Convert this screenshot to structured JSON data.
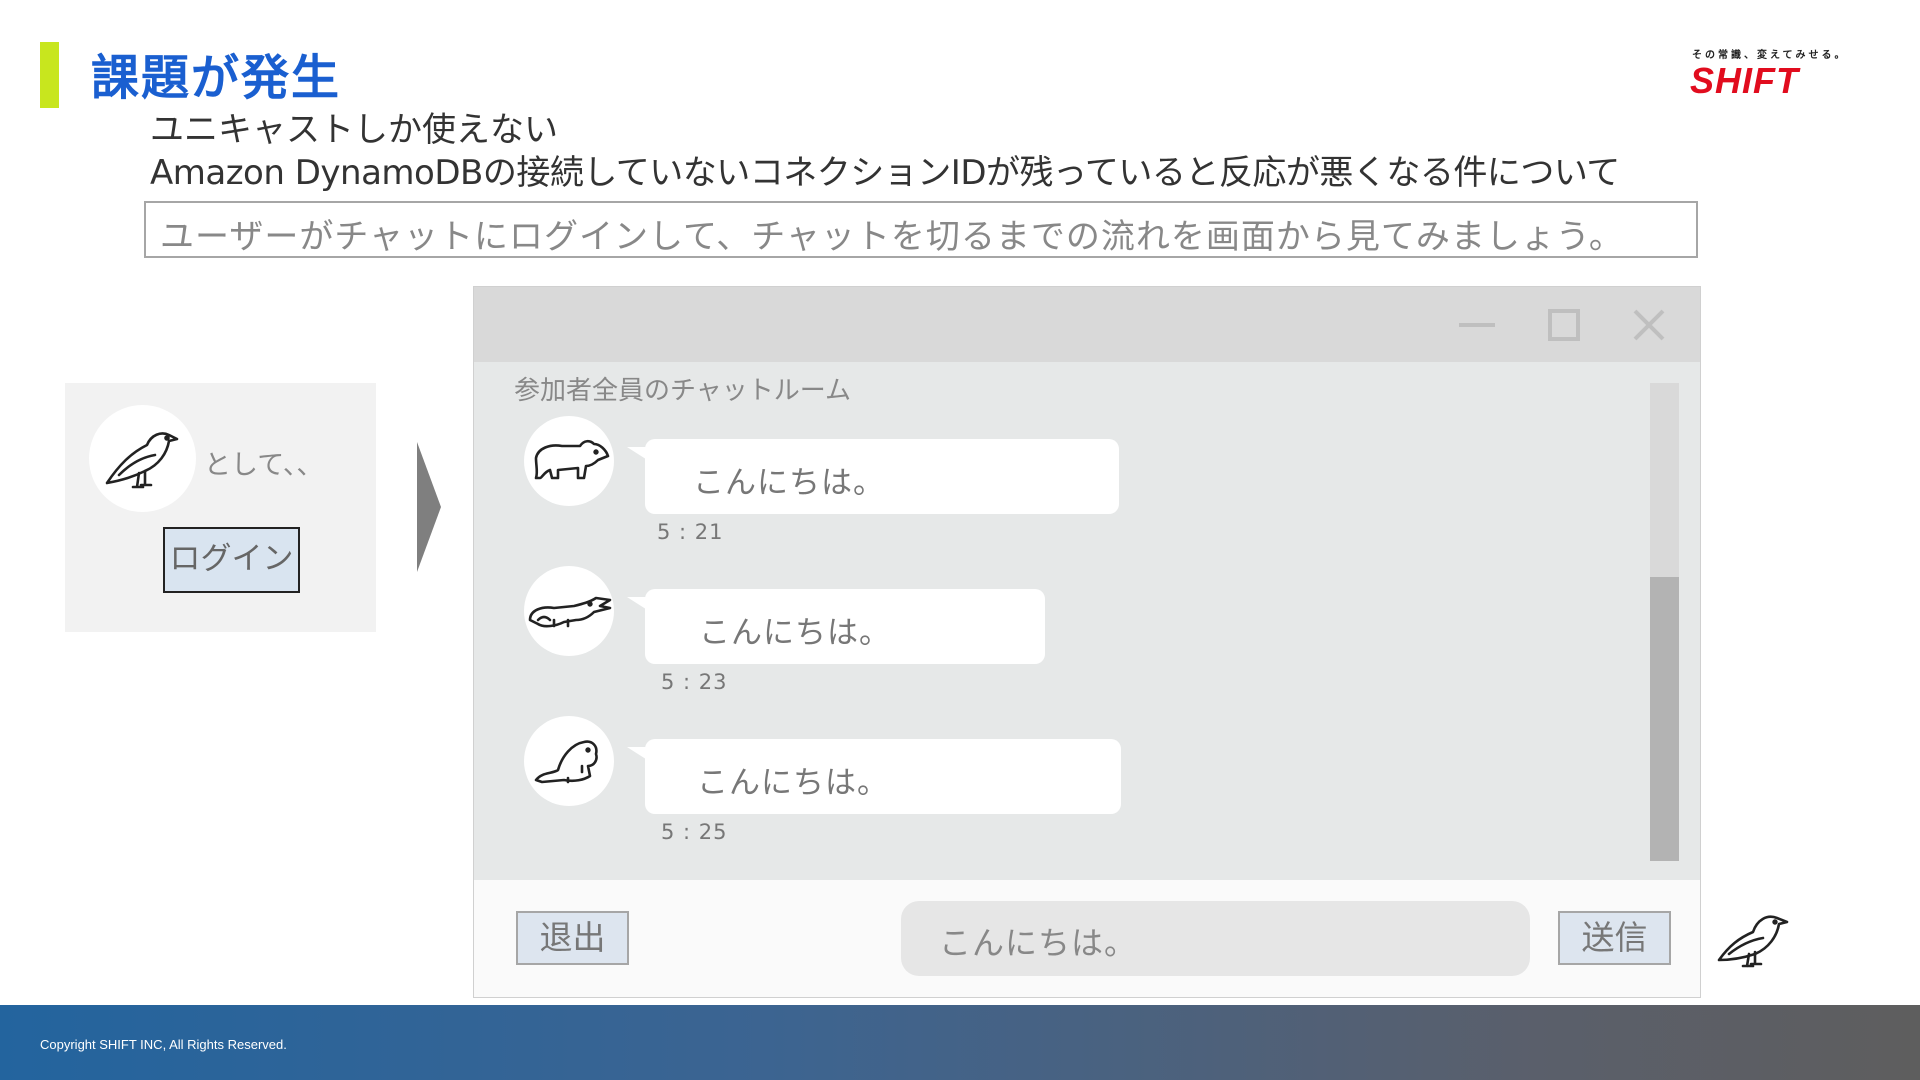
{
  "slide": {
    "title": "課題が発生",
    "subtitle_line1": "ユニキャストしか使えない",
    "subtitle_line2": "Amazon DynamoDBの接続していないコネクションIDが残っていると反応が悪くなる件について",
    "note": "ユーザーがチャットにログインして、チャットを切るまでの流れを画面から見てみましょう。",
    "accent_color": "#c8e61e",
    "title_color": "#1a5fd0"
  },
  "brand": {
    "tagline": "その常識、変えてみせる。",
    "logo_text": "SHIFT",
    "logo_color": "#e10c1e"
  },
  "login": {
    "avatar_icon": "bird-icon",
    "caption": "として、、",
    "button_label": "ログイン"
  },
  "chat_window": {
    "controls": [
      "minimize-icon",
      "maximize-icon",
      "close-icon"
    ],
    "room_title": "参加者全員のチャットルーム",
    "messages": [
      {
        "avatar_icon": "bear-icon",
        "text": "こんにちは。",
        "time": "5 : 21"
      },
      {
        "avatar_icon": "crocodile-icon",
        "text": "こんにちは。",
        "time": "5 : 23"
      },
      {
        "avatar_icon": "beaver-icon",
        "text": "こんにちは。",
        "time": "5 : 25"
      }
    ],
    "exit_label": "退出",
    "input_value": "こんにちは。",
    "send_label": "送信",
    "sender_icon": "bird-icon"
  },
  "footer": {
    "copyright": "Copyright SHIFT INC, All Rights Reserved."
  }
}
